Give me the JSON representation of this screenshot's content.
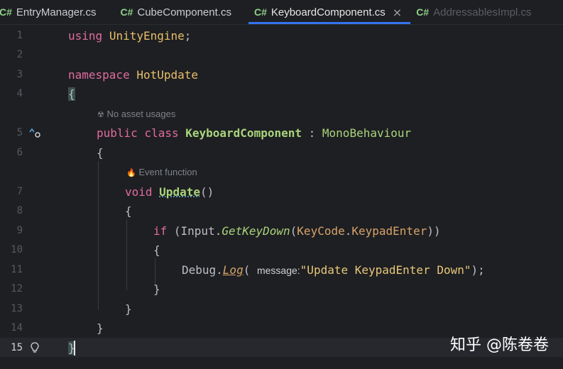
{
  "tabs": [
    {
      "lang": "C#",
      "name": "EntryManager.cs",
      "state": "normal"
    },
    {
      "lang": "C#",
      "name": "CubeComponent.cs",
      "state": "normal"
    },
    {
      "lang": "C#",
      "name": "KeyboardComponent.cs",
      "state": "active",
      "close": "×"
    },
    {
      "lang": "C#",
      "name": "AddressablesImpl.cs",
      "state": "dim"
    }
  ],
  "line_numbers": [
    "1",
    "2",
    "3",
    "4",
    "5",
    "6",
    "7",
    "8",
    "9",
    "10",
    "11",
    "12",
    "13",
    "14",
    "15"
  ],
  "inlay_hints": {
    "asset_usages": "No asset usages",
    "event_function": "Event function"
  },
  "code": {
    "l1_kw": "using",
    "l1_ns": "UnityEngine",
    "l1_end": ";",
    "l3_kw": "namespace",
    "l3_ns": "HotUpdate",
    "l4": "{",
    "l5_kw": "public class",
    "l5_cls": "KeyboardComponent",
    "l5_sep": " : ",
    "l5_base": "MonoBehaviour",
    "l6": "{",
    "l7_kw": "void",
    "l7_meth": "Update",
    "l7_end": "()",
    "l8": "{",
    "l9_kw": "if",
    "l9_a": " (Input.",
    "l9_m": "GetKeyDown",
    "l9_b": "(",
    "l9_enum": "KeyCode",
    "l9_dot": ".",
    "l9_enum2": "KeypadEnter",
    "l9_end": "))",
    "l10": "{",
    "l11_a": "Debug.",
    "l11_log": "Log",
    "l11_paren": "( ",
    "l11_hint": "message:",
    "l11_str": "\"Update KeypadEnter Down\"",
    "l11_end": ");",
    "l12": "}",
    "l13": "}",
    "l14": "}",
    "l15": "}"
  },
  "watermark": "知乎 @陈卷卷",
  "colors": {
    "background": "#1e1f22",
    "keyword": "#e06c9f",
    "namespace": "#e8bf6a",
    "type": "#a9d47c",
    "string": "#e8c77a",
    "tab_accent": "#3574f0"
  },
  "icons": [
    "unity-asset-icon",
    "event-function-icon",
    "implements-gutter-icon",
    "lightbulb-icon",
    "close-icon"
  ]
}
